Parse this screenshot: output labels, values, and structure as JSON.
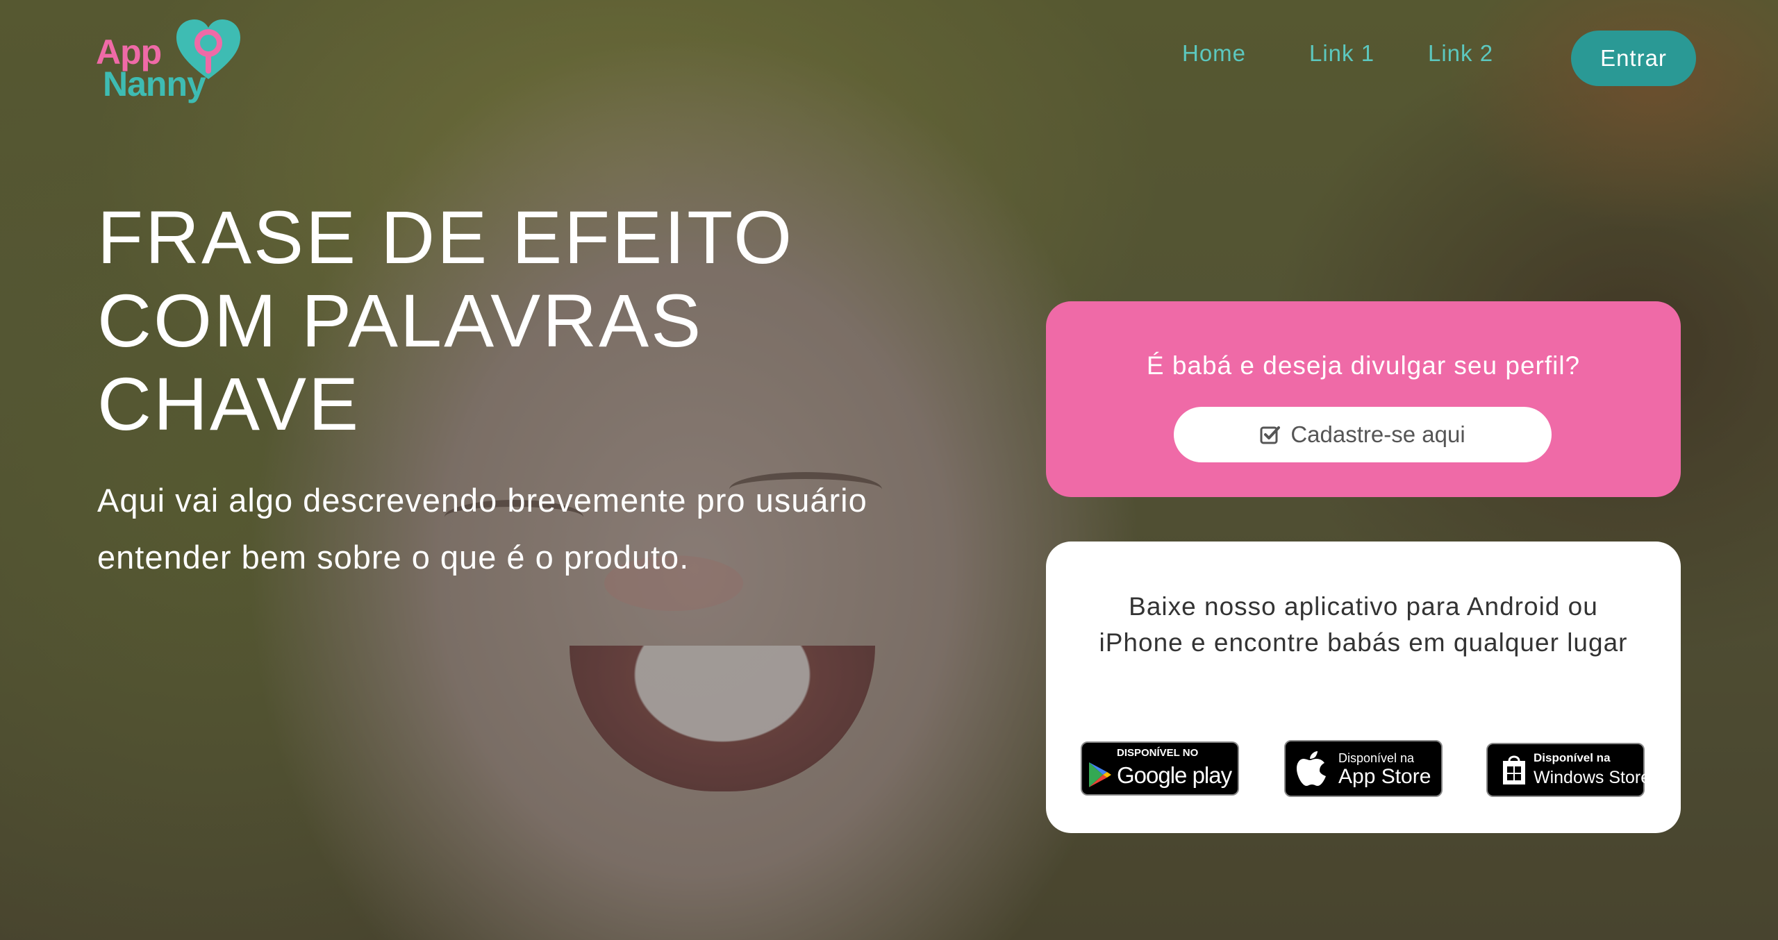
{
  "brand": {
    "logo_line1": "App",
    "logo_line2": "Nanny",
    "colors": {
      "pink": "#ef6aa7",
      "teal": "#3ebcb3",
      "button_teal": "#2a9995"
    }
  },
  "nav": {
    "items": [
      {
        "label": "Home"
      },
      {
        "label": "Link 1"
      },
      {
        "label": "Link 2"
      }
    ],
    "login_label": "Entrar"
  },
  "hero": {
    "title_lines": [
      "FRASE DE EFEITO",
      "COM PALAVRAS",
      "CHAVE"
    ],
    "subtitle": "Aqui vai algo descrevendo brevemente pro usuário entender bem sobre o que é o produto."
  },
  "nanny_card": {
    "question": "É babá e deseja divulgar seu perfil?",
    "button_label": "Cadastre-se aqui",
    "button_icon": "check-square-icon"
  },
  "app_card": {
    "description": "Baixe nosso aplicativo para Android ou iPhone e encontre babás em qualquer lugar",
    "badges": [
      {
        "store": "google-play",
        "small": "DISPONÍVEL NO",
        "big": "Google play"
      },
      {
        "store": "app-store",
        "small": "Disponível na",
        "big": "App Store"
      },
      {
        "store": "windows-store",
        "small": "Disponível na",
        "big": "Windows Store"
      }
    ]
  }
}
